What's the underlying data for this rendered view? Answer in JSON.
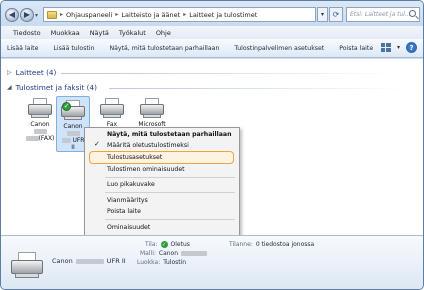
{
  "address": {
    "crumbs": [
      "Ohjauspaneeli",
      "Laitteisto ja äänet",
      "Laitteet ja tulostimet"
    ],
    "search_placeholder": "Etsi: Laitteet ja tul..."
  },
  "menu": [
    "Tiedosto",
    "Muokkaa",
    "Näytä",
    "Työkalut",
    "Ohje"
  ],
  "commands": [
    "Lisää laite",
    "Lisää tulostin",
    "Näytä, mitä tulostetaan parhaillaan",
    "Tulostinpalvelimen asetukset",
    "Poista laite"
  ],
  "groups": {
    "devices": "Laitteet (4)",
    "printers": "Tulostimet ja faksit (4)"
  },
  "devices": [
    {
      "line1": "Canon",
      "line3": "(FAX)"
    },
    {
      "line1": "Canon",
      "line3": "UFR",
      "line4": "II"
    },
    {
      "line1": "Fax"
    },
    {
      "line1": "Microsoft"
    }
  ],
  "context_menu": {
    "see_printing": "Näytä, mitä tulostetaan parhaillaan",
    "set_default": "Määritä oletustulostimeksi",
    "printing_prefs": "Tulostusasetukset",
    "printer_props": "Tulostimen ominaisuudet",
    "create_shortcut": "Luo pikakuvake",
    "troubleshoot": "Vianmääritys",
    "remove": "Poista laite",
    "properties": "Ominaisuudet"
  },
  "details": {
    "name_prefix": "Canon",
    "name_suffix": "UFR II",
    "status_label": "Tila:",
    "status_value": "Oletus",
    "model_label": "Malli:",
    "model_value": "Canon",
    "category_label": "Luokka:",
    "category_value": "Tulostin",
    "queue_label": "Tilanne:",
    "queue_value": "0 tiedostoa jonossa"
  }
}
